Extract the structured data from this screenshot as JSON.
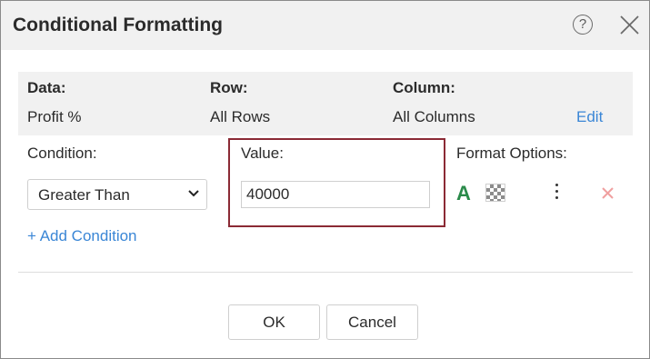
{
  "dialog": {
    "title": "Conditional Formatting",
    "help_icon": "help-circle-icon",
    "close_icon": "close-icon"
  },
  "info": {
    "data_label": "Data:",
    "data_value": "Profit %",
    "row_label": "Row:",
    "row_value": "All Rows",
    "column_label": "Column:",
    "column_value": "All Columns",
    "edit_label": "Edit"
  },
  "condition": {
    "label": "Condition:",
    "selected": "Greater Than",
    "add_label": "+ Add Condition"
  },
  "value": {
    "label": "Value:",
    "current": "40000"
  },
  "format_options": {
    "label": "Format Options:",
    "font_color_glyph": "A",
    "font_color": "#2a8a4a",
    "icons": [
      "font-color-icon",
      "fill-color-icon",
      "more-options-icon",
      "delete-icon"
    ]
  },
  "buttons": {
    "ok": "OK",
    "cancel": "Cancel"
  },
  "colors": {
    "highlight_border": "#8b2a35",
    "link": "#3a86d6",
    "panel_bg": "#f1f1f1"
  }
}
